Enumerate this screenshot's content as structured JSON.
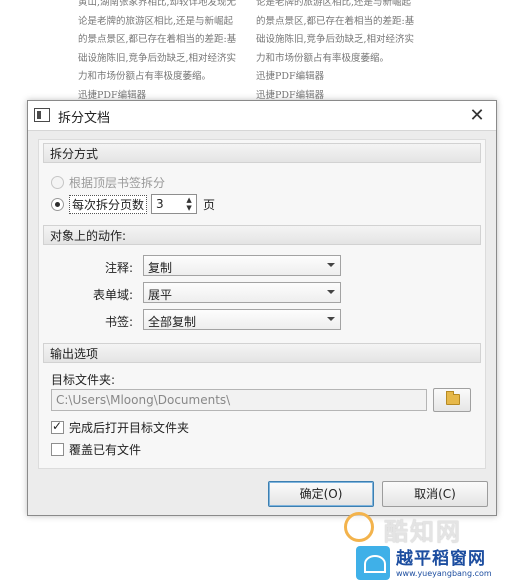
{
  "background_document": {
    "left_lines": [
      "黄山,湖南张家界相比,却较详地发现无",
      "论是老牌的旅游区相比,还是与新崛起",
      "的景点景区,都已存在着相当的差距:基",
      "础设施陈旧,竞争后劲缺乏,相对经济实",
      "力和市场份额占有率极度萎缩。",
      "迅捷PDF编辑器"
    ],
    "right_lines": [
      "论是老牌的旅游区相比,还是与新崛起",
      "的景点景区,都已存在着相当的差距:基",
      "础设施陈旧,竞争后劲缺乏,相对经济实",
      "力和市场份额占有率极度萎缩。",
      "迅捷PDF编辑器",
      "迅捷PDF编辑器"
    ]
  },
  "dialog": {
    "title": "拆分文档",
    "close_glyph": "✕",
    "split_mode": {
      "header": "拆分方式",
      "option_bookmark": "根据顶层书签拆分",
      "option_pages": "每次拆分页数",
      "pages_value": "3",
      "pages_unit": "页"
    },
    "actions": {
      "header": "对象上的动作:",
      "annotation_label": "注释:",
      "annotation_value": "复制",
      "form_field_label": "表单域:",
      "form_field_value": "展平",
      "bookmark_label": "书签:",
      "bookmark_value": "全部复制"
    },
    "output": {
      "header": "输出选项",
      "target_folder_label": "目标文件夹:",
      "target_folder_value": "C:\\Users\\Mloong\\Documents\\",
      "open_after_label": "完成后打开目标文件夹",
      "open_after_checked": true,
      "overwrite_label": "覆盖已有文件",
      "overwrite_checked": false
    },
    "ok_button": "确定(O)",
    "cancel_button": "取消(C)"
  },
  "watermarks": {
    "site1": "酷知网",
    "site2_title": "越平稻窗网",
    "site2_url": "www.yueyangbang.com"
  },
  "colors": {
    "accent_focus": "#3c7fb1",
    "folder_icon": "#e6b84a"
  }
}
